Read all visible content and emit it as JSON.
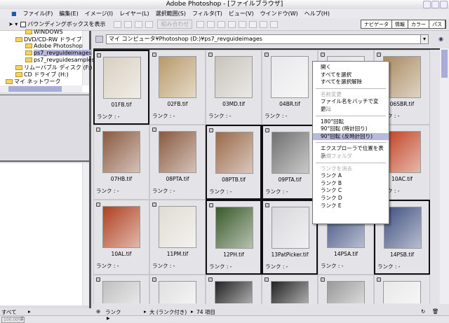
{
  "window": {
    "title": "Adobe Photoshop - [ファイルブラウザ]"
  },
  "menu": [
    "ファイル(F)",
    "編集(E)",
    "イメージ(I)",
    "レイヤー(L)",
    "選択範囲(S)",
    "フィルタ(T)",
    "ビュー(V)",
    "ウインドウ(W)",
    "ヘルプ(H)"
  ],
  "toolbar": {
    "bounding_box_label": "バウンディングボックスを表示",
    "combine_label": "組み合わせ",
    "palettes": [
      "ナビゲータ",
      "情報",
      "カラー",
      "パス"
    ]
  },
  "tree": [
    {
      "label": "WINDOWS",
      "indent": 2
    },
    {
      "label": "DVD/CD-RW ドライブ",
      "indent": 1
    },
    {
      "label": "Adobe Photoshop",
      "indent": 2
    },
    {
      "label": "ps7_revguideimages",
      "indent": 2,
      "selected": true
    },
    {
      "label": "ps7_revguidesamples",
      "indent": 2
    },
    {
      "label": "リムーバブル ディスク (F:)",
      "indent": 1
    },
    {
      "label": "CD ドライブ (H:)",
      "indent": 1
    },
    {
      "label": "マイ ネットワーク",
      "indent": 0
    }
  ],
  "path": {
    "value": "マイ コンピュータ¥Photoshop (D:)¥ps7_revguideimages"
  },
  "rank_label": "ランク : -",
  "files": [
    {
      "name": "01FB.tif",
      "selected": true,
      "color": "#d8cfc0"
    },
    {
      "name": "02FB.tif",
      "color": "#b89a6a"
    },
    {
      "name": "03MD.tif",
      "color": "#c8c4bc"
    },
    {
      "name": "04BR.tif",
      "color": "#e8e8ea"
    },
    {
      "name": "",
      "color": "#e4e4e8"
    },
    {
      "name": "06SBR.tif",
      "color": "#a88a60"
    },
    {
      "name": "07HB.tif",
      "color": "#8a5a40"
    },
    {
      "name": "08PTA.tif",
      "color": "#8a5a40"
    },
    {
      "name": "08PTB.tif",
      "selected": true,
      "color": "#9a6a4a"
    },
    {
      "name": "09PTA.tif",
      "selected": true,
      "color": "#707070"
    },
    {
      "name": "",
      "color": "#e4e4e8"
    },
    {
      "name": "10AC.tif",
      "color": "#c04020"
    },
    {
      "name": "10AL.tif",
      "color": "#b04020"
    },
    {
      "name": "11PM.tif",
      "color": "#e0dcd4"
    },
    {
      "name": "12PH.tif",
      "selected": true,
      "color": "#3a5a2a"
    },
    {
      "name": "13PatPicker.tif",
      "selected": true,
      "color": "#d8d8dc"
    },
    {
      "name": "14PSA.tif",
      "color": "#405080"
    },
    {
      "name": "14PSB.tif",
      "selected": true,
      "color": "#405080"
    },
    {
      "name": "",
      "color": "#c0c0c0"
    },
    {
      "name": "",
      "color": "#e0e0e0"
    },
    {
      "name": "",
      "color": "#222222"
    },
    {
      "name": "",
      "color": "#222222"
    },
    {
      "name": "",
      "color": "#999999"
    },
    {
      "name": "",
      "color": "#e8e8e8"
    }
  ],
  "context_menu": [
    {
      "label": "開く"
    },
    {
      "label": "すべてを選択"
    },
    {
      "label": "すべてを選択解除"
    },
    {
      "sep": true
    },
    {
      "label": "名前変更",
      "disabled": true
    },
    {
      "label": "ファイル名をバッチで変更..."
    },
    {
      "label": "削除",
      "disabled": true
    },
    {
      "sep": true
    },
    {
      "label": "180°回転"
    },
    {
      "label": "90°回転 (時計回り)"
    },
    {
      "label": "90°回転 (反時計回り)",
      "highlighted": true
    },
    {
      "sep": true
    },
    {
      "label": "エクスプローラで位置を表示"
    },
    {
      "label": "新規フォルダ",
      "disabled": true
    },
    {
      "sep": true
    },
    {
      "label": "ランクを消去",
      "disabled": true
    },
    {
      "label": "ランク A"
    },
    {
      "label": "ランク B"
    },
    {
      "label": "ランク C"
    },
    {
      "label": "ランク D"
    },
    {
      "label": "ランク E"
    }
  ],
  "bottom": {
    "left_filter": "すべて",
    "sort": "ランク",
    "view": "大 (ランク付き)",
    "count": "74 項目"
  },
  "status": {
    "zoom": "100.00%"
  }
}
